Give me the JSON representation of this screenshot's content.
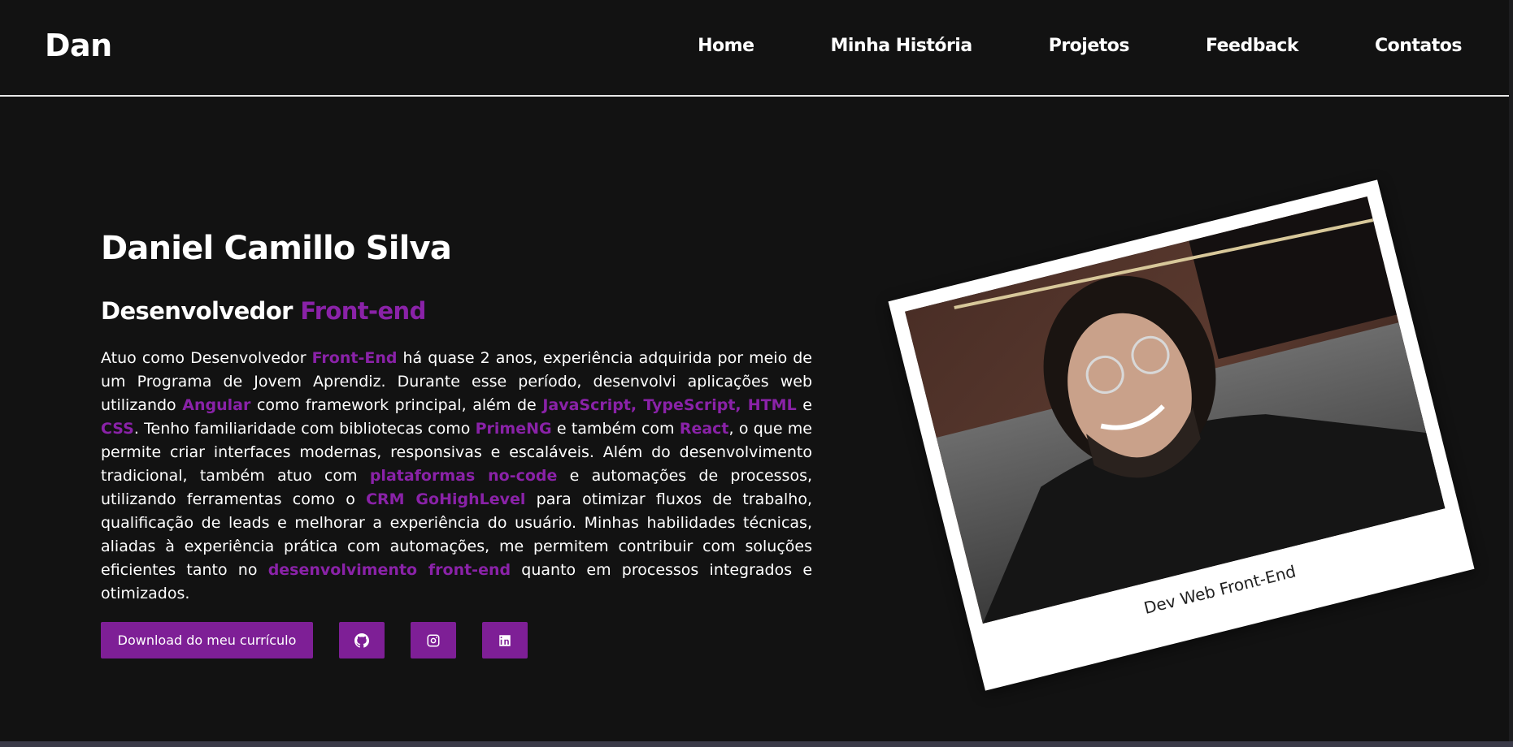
{
  "header": {
    "logo": "Dan",
    "nav": [
      {
        "label": "Home"
      },
      {
        "label": "Minha História"
      },
      {
        "label": "Projetos"
      },
      {
        "label": "Feedback"
      },
      {
        "label": "Contatos"
      }
    ]
  },
  "hero": {
    "name": "Daniel Camillo Silva",
    "role_prefix": "Desenvolvedor ",
    "role_accent": "Front-end",
    "about": [
      {
        "text": "Atuo como Desenvolvedor ",
        "hl": false
      },
      {
        "text": "Front-End",
        "hl": true
      },
      {
        "text": " há quase 2 anos, experiência adquirida por meio de um Programa de Jovem Aprendiz. Durante esse período, desenvolvi aplicações web utilizando ",
        "hl": false
      },
      {
        "text": "Angular",
        "hl": true
      },
      {
        "text": " como framework principal, além de ",
        "hl": false
      },
      {
        "text": "JavaScript, TypeScript, HTML",
        "hl": true
      },
      {
        "text": " e ",
        "hl": false
      },
      {
        "text": "CSS",
        "hl": true
      },
      {
        "text": ". Tenho familiaridade com bibliotecas como ",
        "hl": false
      },
      {
        "text": "PrimeNG",
        "hl": true
      },
      {
        "text": " e também com ",
        "hl": false
      },
      {
        "text": "React",
        "hl": true
      },
      {
        "text": ", o que me permite criar interfaces modernas, responsivas e escaláveis. Além do desenvolvimento tradicional, também atuo com ",
        "hl": false
      },
      {
        "text": "plataformas no-code",
        "hl": true
      },
      {
        "text": " e automações de processos, utilizando ferramentas como o ",
        "hl": false
      },
      {
        "text": "CRM GoHighLevel",
        "hl": true
      },
      {
        "text": " para otimizar fluxos de trabalho, qualificação de leads e melhorar a experiência do usuário. Minhas habilidades técnicas, aliadas à experiência prática com automações, me permitem contribuir com soluções eficientes tanto no ",
        "hl": false
      },
      {
        "text": "desenvolvimento front-end",
        "hl": true
      },
      {
        "text": " quanto em processos integrados e otimizados.",
        "hl": false
      }
    ],
    "download_label": "Download do meu currículo",
    "social": [
      {
        "icon": "github-icon"
      },
      {
        "icon": "instagram-icon"
      },
      {
        "icon": "linkedin-icon"
      }
    ]
  },
  "polaroid": {
    "caption": "Dev Web Front-End"
  },
  "colors": {
    "background": "#121212",
    "accent": "#8a22a8",
    "button": "#7e1f96",
    "text": "#ffffff"
  }
}
